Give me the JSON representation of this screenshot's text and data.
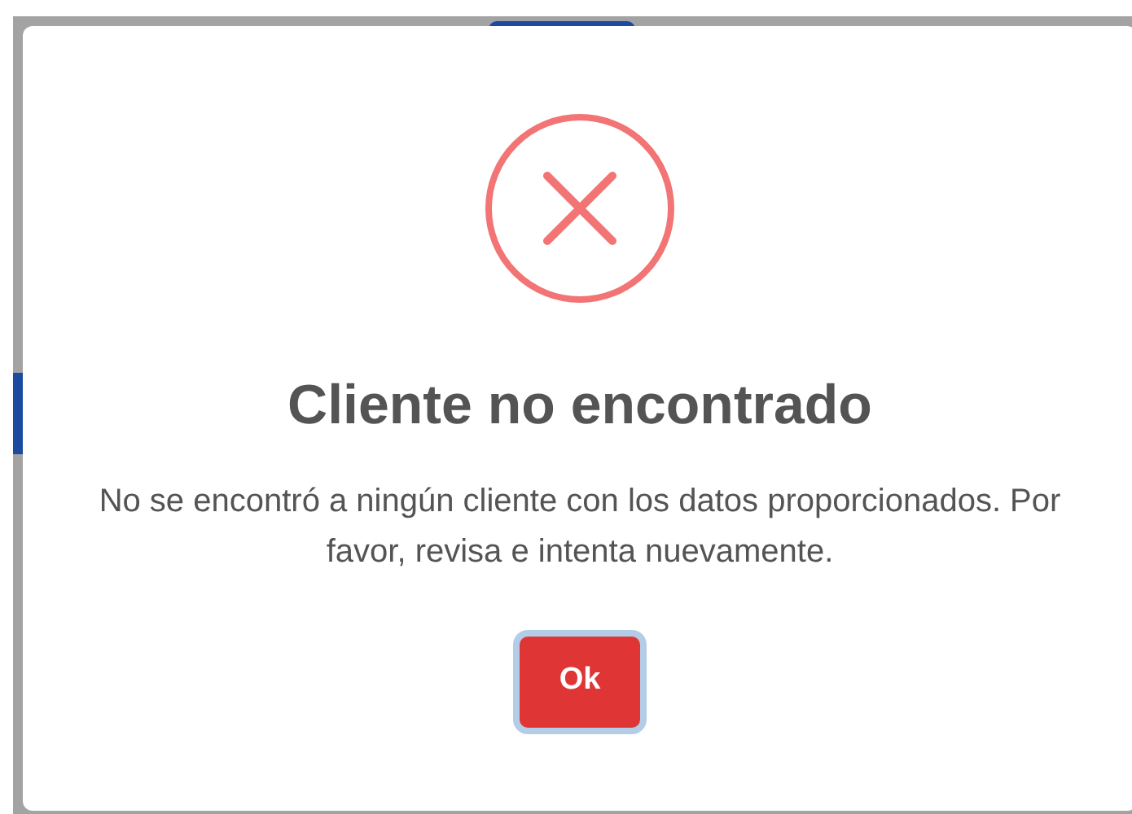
{
  "dialog": {
    "kind": "error",
    "title": "Cliente no encontrado",
    "message": "No se encontró a ningún cliente con los datos proporcionados. Por favor, revisa e intenta nuevamente.",
    "confirm_button": "Ok"
  }
}
